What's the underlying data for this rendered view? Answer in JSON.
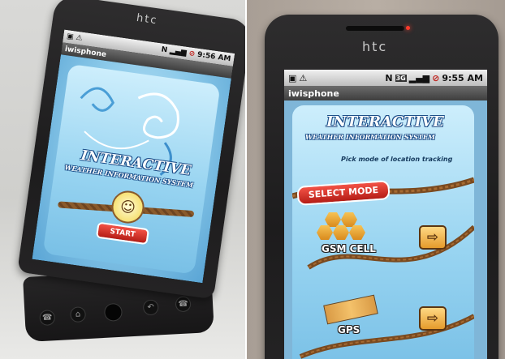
{
  "left_phone": {
    "brand": "htc",
    "status_time": "9:56 AM",
    "app_title": "iwisphone",
    "splash_title_line1": "INTERACTIVE",
    "splash_title_line2": "WEATHER INFORMATION SYSTEM",
    "start_label": "START",
    "nav_icons": [
      "phone-icon",
      "home-icon",
      "trackball-icon",
      "back-icon",
      "end-call-icon"
    ]
  },
  "right_phone": {
    "brand": "htc",
    "status_time": "9:55 AM",
    "network_badge": "3G",
    "app_title": "iwisphone",
    "title_line1": "INTERACTIVE",
    "title_line2": "WEATHER INFORMATION SYSTEM",
    "prompt": "Pick mode of location tracking",
    "select_mode_label": "SELECT MODE",
    "options": [
      {
        "label": "GSM CELL"
      },
      {
        "label": "GPS"
      }
    ]
  },
  "colors": {
    "accent_red": "#d8281f",
    "title_blue": "#1d4f8a",
    "sky_blue": "#8ecbea",
    "button_orange": "#e59b2c"
  }
}
